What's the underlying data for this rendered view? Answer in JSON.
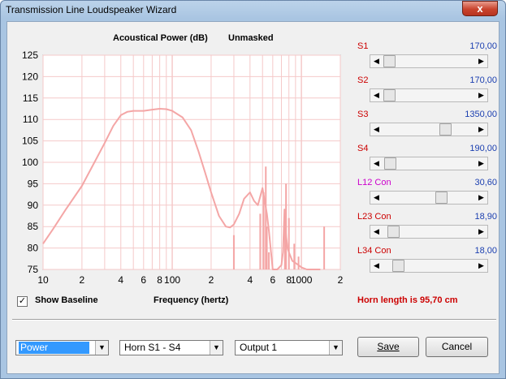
{
  "window": {
    "title": "Transmission Line Loudspeaker Wizard",
    "close_glyph": "x"
  },
  "chart_data": {
    "type": "line",
    "title": "Acoustical Power (dB)",
    "subtitle": "Unmasked",
    "xlabel": "Frequency (hertz)",
    "x_scale": "log",
    "xlim": [
      10,
      2000
    ],
    "ylim": [
      75,
      125
    ],
    "y_ticks": [
      125,
      120,
      115,
      110,
      105,
      100,
      95,
      90,
      85,
      80,
      75
    ],
    "x_tick_labels": [
      {
        "value": 10,
        "label": "10"
      },
      {
        "value": 20,
        "label": "2"
      },
      {
        "value": 40,
        "label": "4"
      },
      {
        "value": 60,
        "label": "6"
      },
      {
        "value": 80,
        "label": "8"
      },
      {
        "value": 100,
        "label": "100"
      },
      {
        "value": 200,
        "label": "2"
      },
      {
        "value": 400,
        "label": "4"
      },
      {
        "value": 600,
        "label": "6"
      },
      {
        "value": 800,
        "label": "8"
      },
      {
        "value": 1000,
        "label": "1000"
      },
      {
        "value": 2000,
        "label": "2"
      }
    ],
    "grid": true,
    "line_color": "#f4a6a6",
    "grid_color": "#f5c9c9",
    "series": [
      {
        "x": [
          10,
          12,
          15,
          20,
          25,
          30,
          35,
          40,
          45,
          50,
          60,
          70,
          80,
          90,
          100,
          120,
          140,
          160,
          180,
          200,
          230,
          260,
          280,
          300,
          330,
          360,
          400,
          430,
          460,
          480,
          500,
          520,
          540,
          560,
          600,
          650,
          700,
          720,
          740,
          760,
          780,
          800,
          850,
          900,
          950,
          1000,
          1100,
          1200,
          1300,
          1400
        ],
        "y": [
          81,
          84.5,
          89,
          94.5,
          100,
          104.5,
          108.5,
          111,
          111.8,
          112,
          112,
          112.3,
          112.5,
          112.4,
          112,
          110.5,
          107.5,
          102.5,
          97.5,
          93,
          87.5,
          85,
          84.8,
          85.5,
          88,
          91.5,
          93,
          91,
          90,
          92,
          94,
          91,
          88,
          84,
          75,
          75,
          76,
          79,
          89,
          83,
          80,
          79,
          77,
          76.5,
          76,
          75.5,
          75,
          75,
          75,
          75
        ]
      }
    ],
    "spikes": [
      {
        "x": 300,
        "y": 83
      },
      {
        "x": 480,
        "y": 88
      },
      {
        "x": 510,
        "y": 93
      },
      {
        "x": 530,
        "y": 99
      },
      {
        "x": 540,
        "y": 85
      },
      {
        "x": 560,
        "y": 79
      },
      {
        "x": 745,
        "y": 89
      },
      {
        "x": 760,
        "y": 95
      },
      {
        "x": 800,
        "y": 87
      },
      {
        "x": 880,
        "y": 81
      },
      {
        "x": 950,
        "y": 78
      },
      {
        "x": 1500,
        "y": 85
      }
    ]
  },
  "sliders": [
    {
      "label": "S1",
      "value": "170,00",
      "label_color": "#cc0000",
      "fraction": 0.01
    },
    {
      "label": "S2",
      "value": "170,00",
      "label_color": "#cc0000",
      "fraction": 0.01
    },
    {
      "label": "S3",
      "value": "1350,00",
      "label_color": "#cc0000",
      "fraction": 0.71
    },
    {
      "label": "S4",
      "value": "190,00",
      "label_color": "#cc0000",
      "fraction": 0.02
    },
    {
      "label": "L12  Con",
      "value": "30,60",
      "label_color": "#cc00cc",
      "fraction": 0.66
    },
    {
      "label": "L23  Con",
      "value": "18,90",
      "label_color": "#cc0000",
      "fraction": 0.06
    },
    {
      "label": "L34  Con",
      "value": "18,00",
      "label_color": "#cc0000",
      "fraction": 0.12
    }
  ],
  "show_baseline": {
    "checked_glyph": "✓",
    "label": "Show Baseline"
  },
  "horn_length": "Horn length is 95,70 cm",
  "combos": [
    {
      "name": "power-combo",
      "value": "Power",
      "selected": true
    },
    {
      "name": "horn-combo",
      "value": "Horn S1 - S4",
      "selected": false
    },
    {
      "name": "output-combo",
      "value": "Output 1",
      "selected": false
    }
  ],
  "buttons": {
    "save": "Save",
    "cancel": "Cancel"
  }
}
